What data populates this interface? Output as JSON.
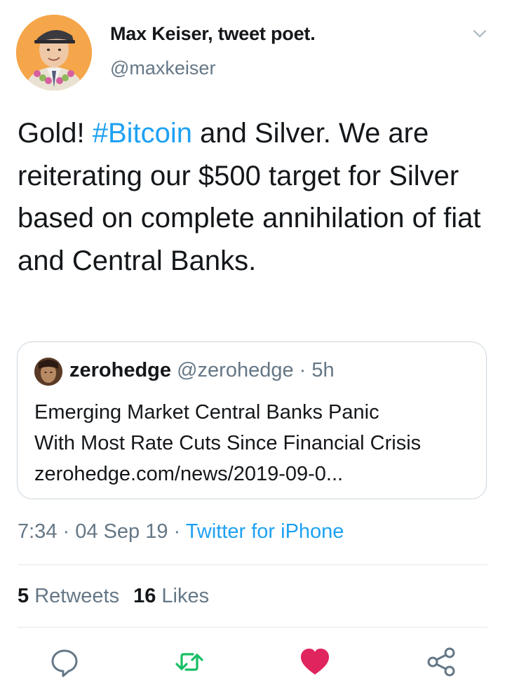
{
  "author": {
    "name": "Max Keiser, tweet poet.",
    "handle": "@maxkeiser"
  },
  "tweet": {
    "text_before": "Gold! ",
    "hashtag": "#Bitcoin",
    "text_after": " and Silver. We are reiterating our $500 target for Silver based on complete annihilation of fiat and Central Banks."
  },
  "quote": {
    "name": "zerohedge",
    "handle": "@zerohedge",
    "separator": "·",
    "time": "5h",
    "lines": [
      "Emerging Market Central Banks Panic",
      "With Most Rate Cuts Since Financial Crisis",
      "zerohedge.com/news/2019-09-0..."
    ]
  },
  "meta": {
    "time": "7:34",
    "separator": "·",
    "date": "04 Sep 19",
    "source": "Twitter for iPhone"
  },
  "stats": {
    "retweets_count": "5",
    "retweets_label": "Retweets",
    "likes_count": "16",
    "likes_label": "Likes"
  },
  "actions": [
    {
      "icon": "reply-icon"
    },
    {
      "icon": "retweet-icon",
      "color": "#17bf63"
    },
    {
      "icon": "like-icon",
      "color": "#e0245e"
    },
    {
      "icon": "share-icon"
    }
  ],
  "colors": {
    "link": "#1da1f2",
    "secondary_text": "#657786",
    "retweeted": "#17bf63",
    "liked": "#e0245e"
  }
}
